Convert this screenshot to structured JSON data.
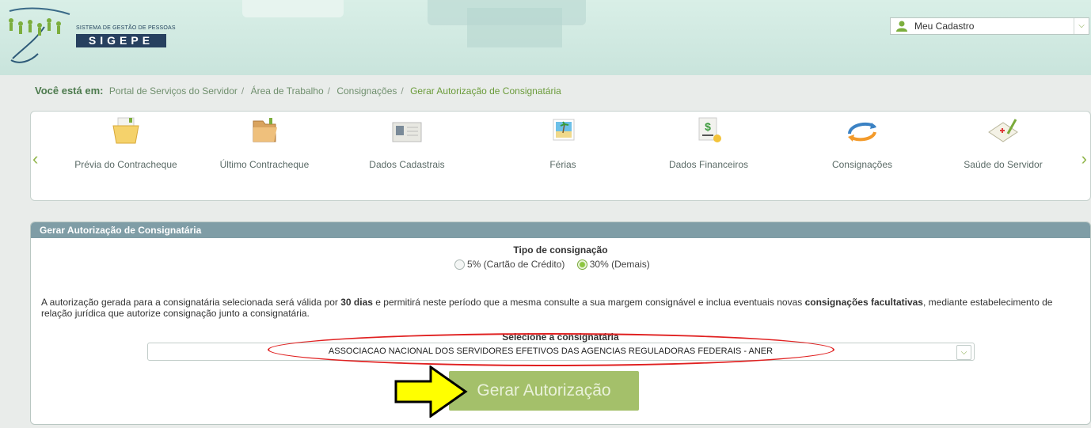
{
  "header": {
    "system_subtitle": "SISTEMA DE GESTÃO DE PESSOAS",
    "system_name": "SIGEPE",
    "user_menu": {
      "label": "Meu Cadastro",
      "icon": "user-icon"
    }
  },
  "breadcrumb": {
    "lead": "Você está em:",
    "items": [
      "Portal de Serviços do Servidor",
      "Área de Trabalho",
      "Consignações",
      "Gerar Autorização de Consignatária"
    ]
  },
  "carousel": {
    "items": [
      {
        "label": "Prévia do Contracheque",
        "icon": "folder-document-icon"
      },
      {
        "label": "Último Contracheque",
        "icon": "folder-open-icon"
      },
      {
        "label": "Dados Cadastrais",
        "icon": "id-card-icon"
      },
      {
        "label": "Férias",
        "icon": "beach-photo-icon"
      },
      {
        "label": "Dados Financeiros",
        "icon": "money-icon"
      },
      {
        "label": "Consignações",
        "icon": "refresh-arrows-icon"
      },
      {
        "label": "Saúde do Servidor",
        "icon": "health-form-icon"
      }
    ]
  },
  "panel": {
    "title": "Gerar Autorização de Consignatária",
    "tipo_title": "Tipo de consignação",
    "options": [
      {
        "label": "5% (Cartão de Crédito)",
        "selected": false
      },
      {
        "label": "30% (Demais)",
        "selected": true
      }
    ],
    "notice": {
      "part1": "A autorização gerada para a consignatária selecionada será válida por ",
      "bold1": "30 dias",
      "part2": " e permitirá neste período que a mesma consulte a sua margem consignável e inclua eventuais novas ",
      "bold2": "consignações facultativas",
      "part3": ", mediante estabelecimento de relação jurídica que autorize consignação junto a consignatária."
    },
    "select_title": "Selecione a consignatária",
    "selected_value": "ASSOCIACAO NACIONAL DOS SERVIDORES EFETIVOS DAS AGENCIAS REGULADORAS FEDERAIS - ANER",
    "button_label": "Gerar Autorização"
  },
  "colors": {
    "accent_green": "#8dc63f",
    "panel_header": "#7f9da6",
    "annotation_red": "#e02020",
    "annotation_arrow": "#ffff00"
  }
}
